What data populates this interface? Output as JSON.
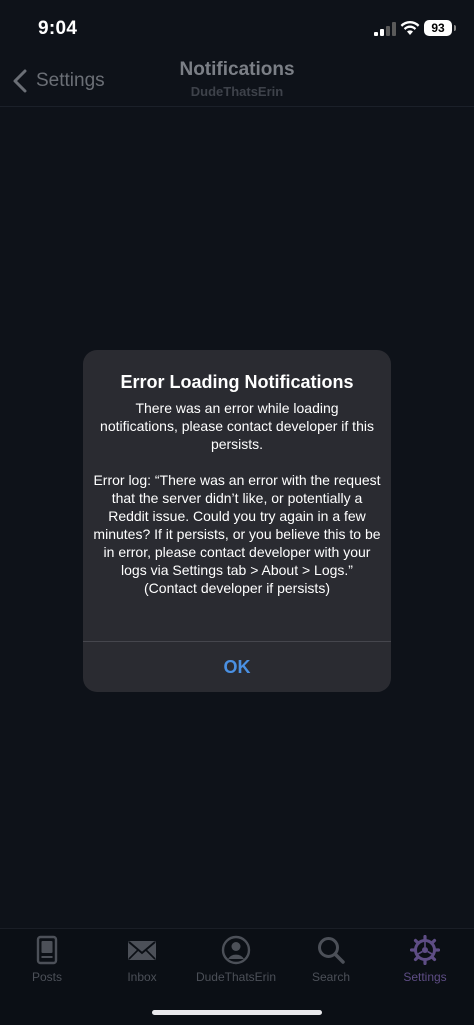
{
  "status_bar": {
    "time": "9:04",
    "battery": "93"
  },
  "nav": {
    "back_label": "Settings",
    "title": "Notifications",
    "subtitle": "DudeThatsErin"
  },
  "alert": {
    "title": "Error Loading Notifications",
    "message": "There was an error while loading notifications, please contact developer if this persists.",
    "log": "Error log: “There was an error with the request that the server didn’t like, or potentially a Reddit issue. Could you try again in a few minutes? If it persists, or you believe this to be in error, please contact developer with your logs via Settings tab > About > Logs.” (Contact developer if persists)",
    "ok_label": "OK"
  },
  "tabs": [
    {
      "label": "Posts",
      "icon": "posts-icon"
    },
    {
      "label": "Inbox",
      "icon": "inbox-icon"
    },
    {
      "label": "DudeThatsErin",
      "icon": "profile-icon"
    },
    {
      "label": "Search",
      "icon": "search-icon"
    },
    {
      "label": "Settings",
      "icon": "gear-icon",
      "active": true
    }
  ],
  "colors": {
    "background": "#0e1219",
    "alert_background": "#2a2b31",
    "accent_ok": "#4a90e2",
    "active_tab": "#5e4d85"
  }
}
